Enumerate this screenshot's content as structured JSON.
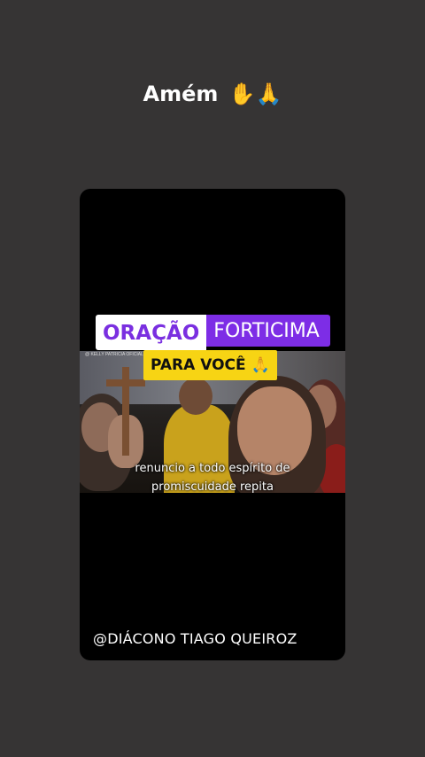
{
  "caption": {
    "text": "Amém",
    "emoji": "✋🙏"
  },
  "video_card": {
    "title_part1": "ORAÇÃO",
    "title_part2": "FORTICIMA",
    "banner": "PARA VOCÊ 🙏",
    "watermark": "@ KELLY PATRICIA OFICIAL",
    "subtitle_line1": "renuncio a todo espírito de",
    "subtitle_line2": "promiscuidade repita",
    "handle": "@DIÁCONO TIAGO QUEIROZ"
  },
  "colors": {
    "background": "#363434",
    "title_purple": "#7d2de6",
    "banner_yellow": "#f7d414"
  }
}
